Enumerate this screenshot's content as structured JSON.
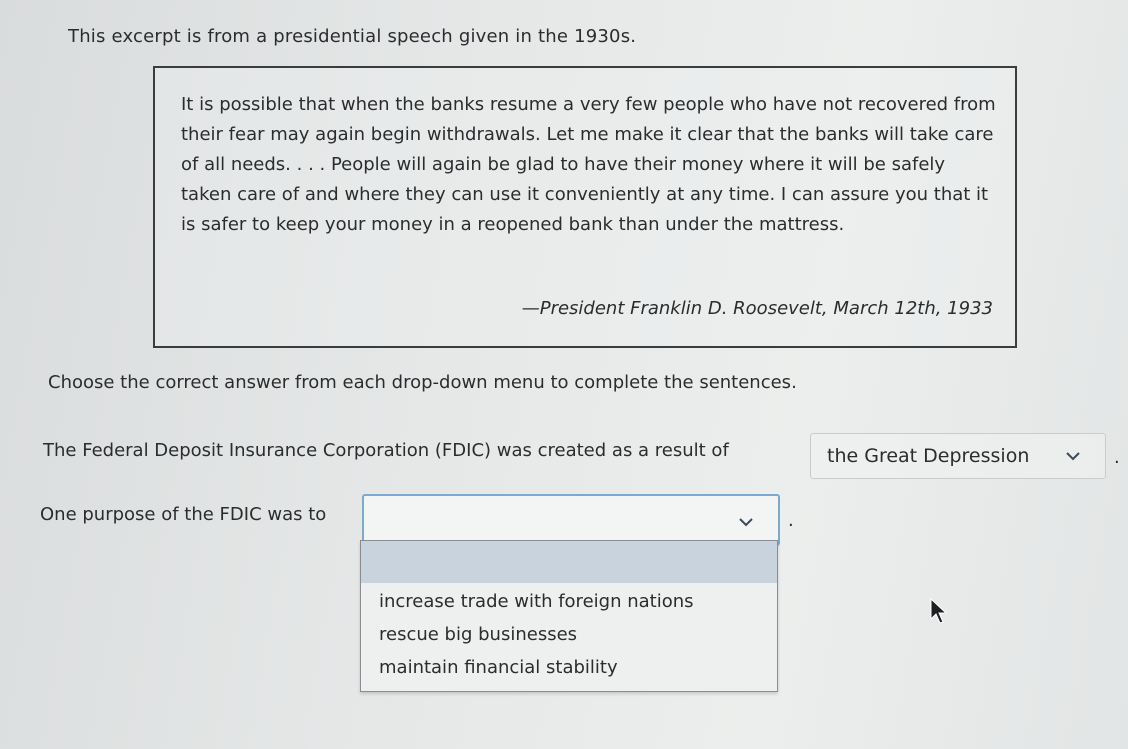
{
  "intro": "This excerpt is from a presidential speech given in the 1930s.",
  "quote": {
    "text": "It is possible that when the banks resume a very few people who have not recovered from their fear may again begin withdrawals. Let me make it clear that the banks will take care of all needs. . . . People will again be glad to have their money where it will be safely taken care of and where they can use it conveniently at any time. I can assure you that it is safer to keep your money in a reopened bank than under the mattress.",
    "attribution": "—President Franklin D. Roosevelt, March 12th, 1933"
  },
  "instruction": "Choose the correct answer from each drop-down menu to complete the sentences.",
  "question1": {
    "prompt": "The Federal Deposit Insurance Corporation (FDIC) was created as a result of",
    "selected": "the Great Depression",
    "end": "."
  },
  "question2": {
    "prompt": "One purpose of the FDIC was to",
    "selected": "",
    "end": ".",
    "options": [
      "",
      "increase trade with foreign nations",
      "rescue big businesses",
      "maintain financial stability"
    ]
  },
  "icons": {
    "dropdown": "chevron-down-icon",
    "cursor": "mouse-pointer-icon"
  },
  "colors": {
    "focus_border": "#7aa9d6",
    "highlight": "#c9d3dd"
  }
}
